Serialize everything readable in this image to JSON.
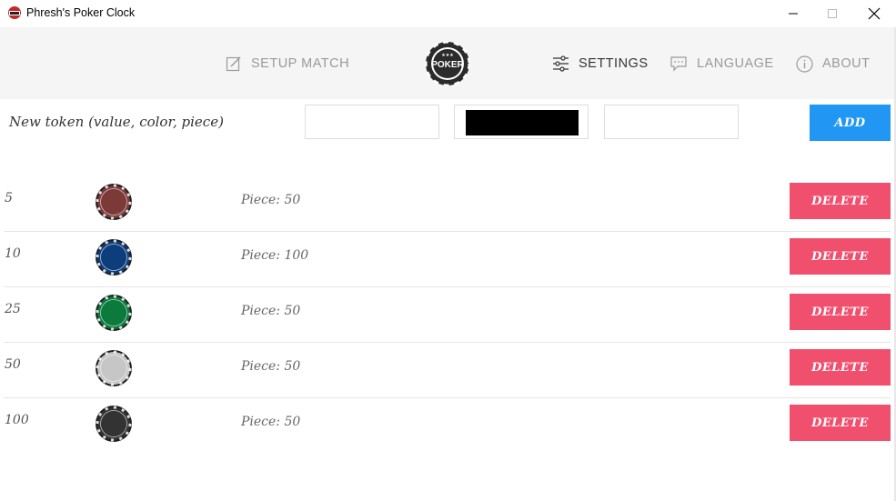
{
  "window": {
    "title": "Phresh's Poker Clock",
    "controls": [
      "minimize-icon",
      "maximize-icon",
      "close-icon"
    ]
  },
  "nav": {
    "items": [
      {
        "label": "SETUP MATCH",
        "icon": "edit-icon",
        "active": false
      },
      {
        "label": "SETTINGS",
        "icon": "sliders-icon",
        "active": true
      },
      {
        "label": "LANGUAGE",
        "icon": "chat-icon",
        "active": false
      },
      {
        "label": "ABOUT",
        "icon": "info-icon",
        "active": false
      }
    ],
    "logo": {
      "text": "POKER",
      "icon": "poker-chip-logo"
    }
  },
  "new_token": {
    "label": "New token (value, color, piece)",
    "value_field": "",
    "color_field": "#000000",
    "piece_field": "",
    "add_label": "ADD"
  },
  "tokens": [
    {
      "value": "5",
      "chip_color": "#7b3a38",
      "piece_text": "Piece: 50",
      "delete_label": "DELETE"
    },
    {
      "value": "10",
      "chip_color": "#0d3d7a",
      "piece_text": "Piece: 100",
      "delete_label": "DELETE"
    },
    {
      "value": "25",
      "chip_color": "#0b7a3c",
      "piece_text": "Piece: 50",
      "delete_label": "DELETE"
    },
    {
      "value": "50",
      "chip_color": "#c6c6c6",
      "piece_text": "Piece: 50",
      "delete_label": "DELETE"
    },
    {
      "value": "100",
      "chip_color": "#333333",
      "piece_text": "Piece: 50",
      "delete_label": "DELETE"
    }
  ],
  "colors": {
    "accent_blue": "#2196f3",
    "delete_red": "#f0506e",
    "nav_bg": "#f5f5f5"
  }
}
